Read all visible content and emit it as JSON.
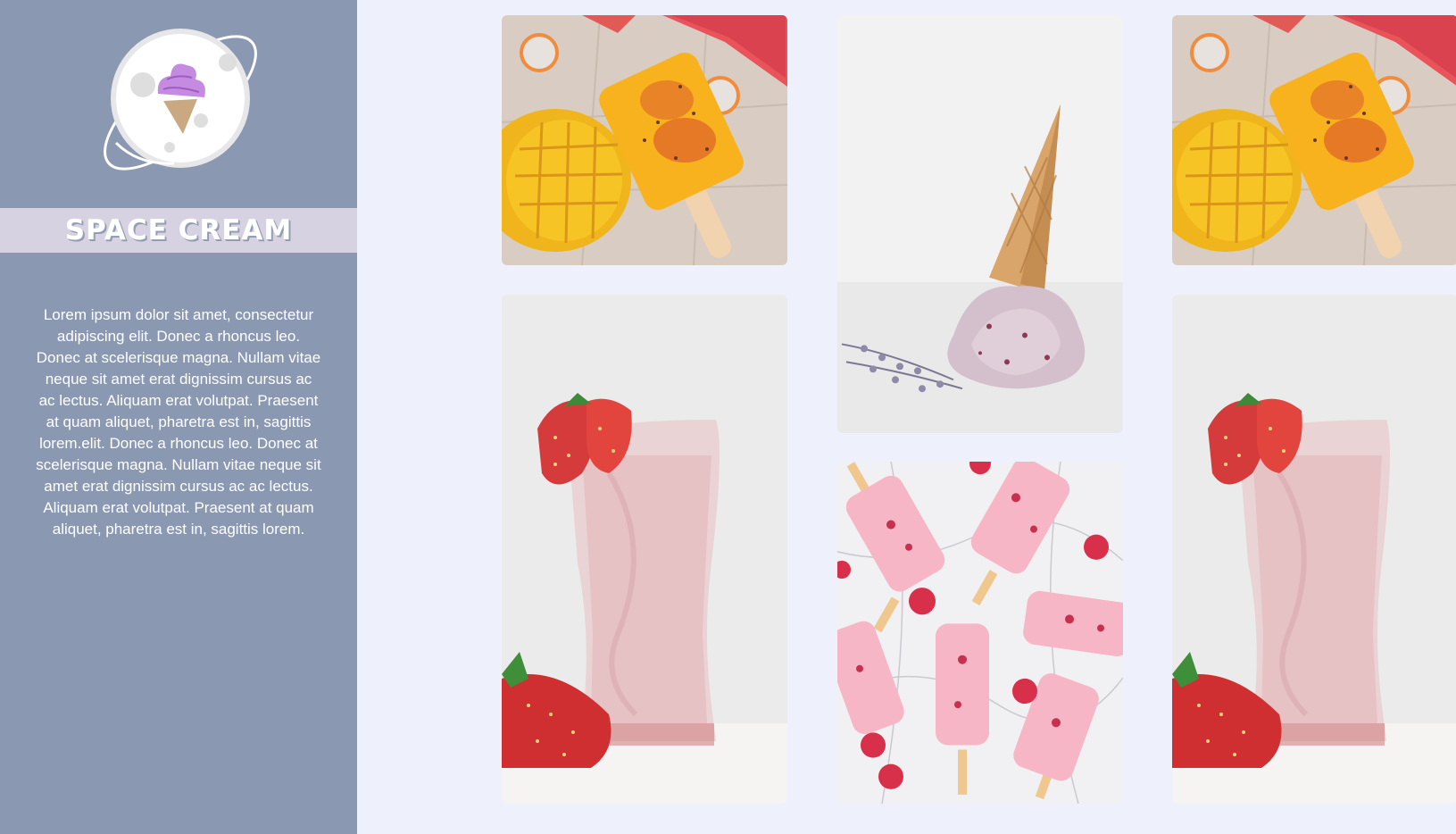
{
  "brand": {
    "name": "Space Cream",
    "logo_icon": "ice-cream-planet-icon"
  },
  "sidebar": {
    "description": "Lorem ipsum dolor sit amet, consectetur adipiscing elit. Donec a rhoncus leo. Donec at scelerisque magna. Nullam vitae neque sit amet erat dignissim cursus ac ac lectus. Aliquam erat volutpat. Praesent at quam aliquet, pharetra est in, sagittis lorem.elit. Donec a rhoncus leo. Donec at scelerisque magna. Nullam vitae neque sit amet erat dignissim cursus ac ac lectus. Aliquam erat volutpat. Praesent at quam aliquet, pharetra est in, sagittis lorem."
  },
  "gallery": {
    "photos": [
      {
        "subject": "mango-popsicle-photo"
      },
      {
        "subject": "fallen-ice-cream-cone-photo"
      },
      {
        "subject": "mango-popsicle-photo"
      },
      {
        "subject": "strawberry-milkshake-photo"
      },
      {
        "subject": "raspberry-popsicles-photo"
      },
      {
        "subject": "strawberry-milkshake-photo"
      }
    ]
  },
  "colors": {
    "sidebar": "#8a98b1",
    "title_band": "#d6d2e1",
    "page_background": "#eef0fc",
    "text": "#ffffff"
  }
}
